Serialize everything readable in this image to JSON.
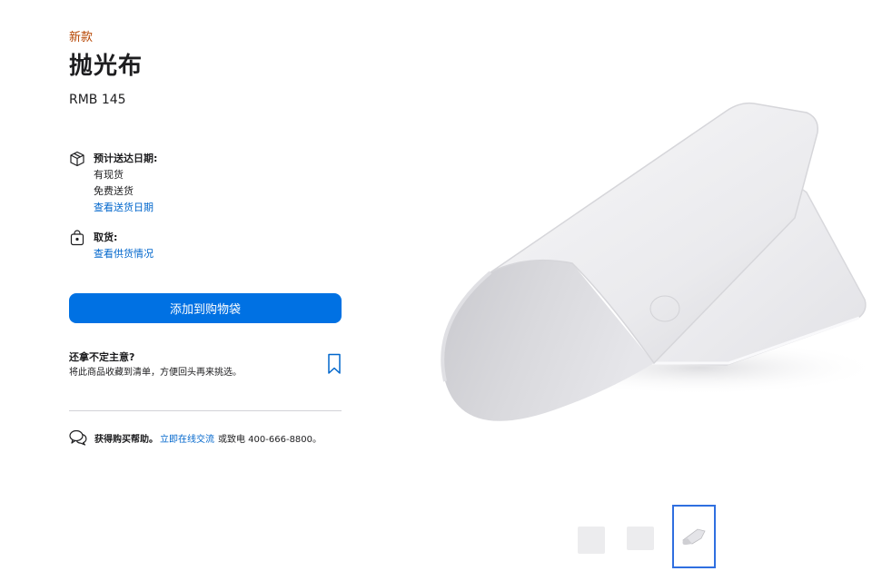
{
  "product": {
    "badge": "新款",
    "title": "抛光布",
    "price": "RMB 145"
  },
  "delivery": {
    "icon": "box-icon",
    "title": "预计送达日期:",
    "stock": "有现货",
    "shipping": "免费送货",
    "link": "查看送货日期"
  },
  "pickup": {
    "icon": "store-bag-icon",
    "title": "取货:",
    "link": "查看供货情况"
  },
  "cta": {
    "add_to_bag": "添加到购物袋"
  },
  "save_later": {
    "title": "还拿不定主意?",
    "description": "将此商品收藏到清单，方便回头再来挑选。",
    "icon": "bookmark-icon"
  },
  "help": {
    "icon": "chat-bubbles-icon",
    "label": "获得购买帮助。",
    "link": "立即在线交流",
    "tail": "或致电 400-666-8800。"
  },
  "gallery": {
    "thumbnail_count": 3,
    "selected_index": 2
  },
  "colors": {
    "accent": "#0071e3",
    "link": "#0066cc",
    "badge": "#b64400"
  }
}
